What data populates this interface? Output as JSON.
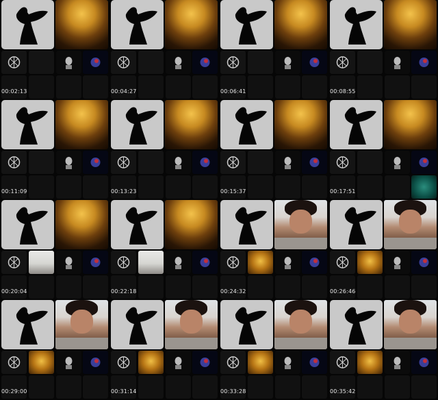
{
  "timestamps": [
    "00:02:13",
    "00:04:27",
    "00:06:41",
    "00:08:55",
    "00:11:09",
    "00:13:23",
    "00:15:37",
    "00:17:51",
    "00:20:04",
    "00:22:18",
    "00:24:32",
    "00:26:46",
    "00:29:00",
    "00:31:14",
    "00:33:28",
    "00:35:42"
  ],
  "icons": {
    "angel": "angel-silhouette-icon",
    "rune": "rune-emblem-icon",
    "skull": "skull-avatar-icon",
    "globe": "globe-avatar-icon"
  },
  "colors": {
    "background": "#000000",
    "tile": "#141414",
    "gold": "#d29a2c",
    "timestamp": "#e8e8e8"
  }
}
